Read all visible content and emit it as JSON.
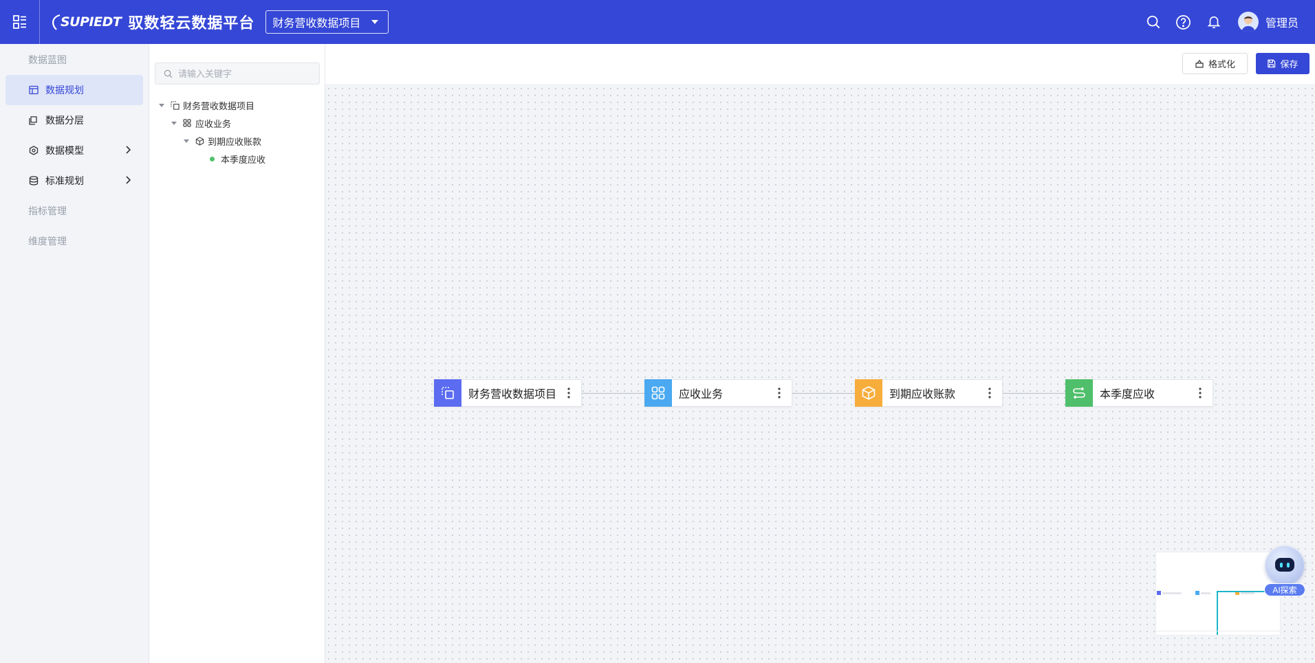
{
  "header": {
    "logo_text": "SUPIEDT",
    "app_title": "驭数轻云数据平台",
    "project_selector": "财务营收数据项目",
    "user_name": "管理员",
    "icons": [
      "menu-icon",
      "search-icon",
      "help-icon",
      "bell-icon"
    ]
  },
  "sidebar": {
    "group_blueprint": "数据蓝图",
    "items": [
      {
        "label": "数据规划",
        "icon": "layout-icon",
        "active": true
      },
      {
        "label": "数据分层",
        "icon": "layers-icon"
      },
      {
        "label": "数据模型",
        "icon": "model-icon",
        "expandable": true
      },
      {
        "label": "标准规划",
        "icon": "database-icon",
        "expandable": true
      }
    ],
    "group_metrics": "指标管理",
    "group_dimensions": "维度管理"
  },
  "tree": {
    "search_placeholder": "请输入关键字",
    "nodes": [
      {
        "label": "财务营收数据项目",
        "icon": "project-icon"
      },
      {
        "label": "应收业务",
        "icon": "grid-icon"
      },
      {
        "label": "到期应收账款",
        "icon": "cube-icon"
      },
      {
        "label": "本季度应收",
        "icon": "dot"
      }
    ]
  },
  "toolbar": {
    "format_label": "格式化",
    "save_label": "保存"
  },
  "flow": {
    "nodes": [
      {
        "label": "财务营收数据项目",
        "color": "#5b6cf0",
        "icon": "project-icon"
      },
      {
        "label": "应收业务",
        "color": "#4aa9f0",
        "icon": "grid-icon"
      },
      {
        "label": "到期应收账款",
        "color": "#f7ad3c",
        "icon": "cube-icon"
      },
      {
        "label": "本季度应收",
        "color": "#4fbf6b",
        "icon": "flow-icon"
      }
    ]
  },
  "ai_bot": {
    "label": "AI探索"
  }
}
